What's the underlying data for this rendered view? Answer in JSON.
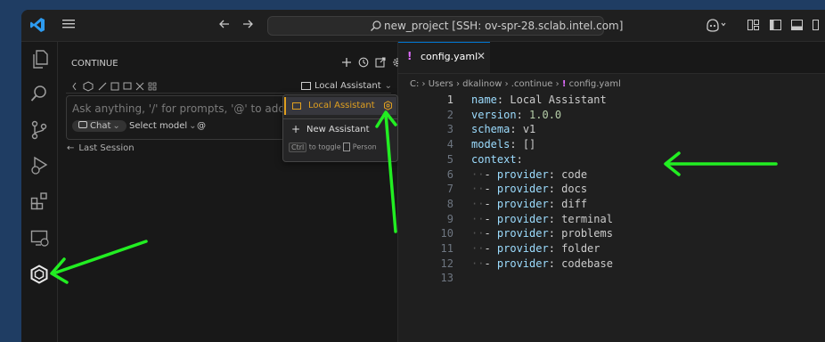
{
  "titlebar": {
    "search_text": "new_project [SSH: ov-spr-28.sclab.intel.com]"
  },
  "sidebar": {
    "title": "CONTINUE",
    "assistant_select": "Local Assistant",
    "input_placeholder": "Ask anything, '/' for prompts, '@' to add conte",
    "chat_label": "Chat",
    "select_model_label": "Select model",
    "at_label": "@",
    "last_session_label": "Last Session"
  },
  "dropdown": {
    "item_local": "Local Assistant",
    "item_new": "New Assistant",
    "hint_key": "Ctrl",
    "hint_text": "to toggle",
    "hint_extra": "Person"
  },
  "editor": {
    "tab_label": "config.yaml",
    "tab_icon": "!",
    "breadcrumb": [
      "C:",
      "Users",
      "dkalinow",
      ".continue",
      "config.yaml"
    ],
    "lines": [
      {
        "n": "1",
        "indent": "",
        "key": "name",
        "val": "Local Assistant",
        "vtype": "str"
      },
      {
        "n": "2",
        "indent": "",
        "key": "version",
        "val": "1.0.0",
        "vtype": "num"
      },
      {
        "n": "3",
        "indent": "",
        "key": "schema",
        "val": "v1",
        "vtype": "str"
      },
      {
        "n": "4",
        "indent": "",
        "key": "models",
        "val": "[]",
        "vtype": "str"
      },
      {
        "n": "5",
        "indent": "",
        "key": "context",
        "val": "",
        "vtype": "str"
      },
      {
        "n": "6",
        "indent": "- ",
        "key": "provider",
        "val": "code",
        "vtype": "str"
      },
      {
        "n": "7",
        "indent": "- ",
        "key": "provider",
        "val": "docs",
        "vtype": "str"
      },
      {
        "n": "8",
        "indent": "- ",
        "key": "provider",
        "val": "diff",
        "vtype": "str"
      },
      {
        "n": "9",
        "indent": "- ",
        "key": "provider",
        "val": "terminal",
        "vtype": "str"
      },
      {
        "n": "10",
        "indent": "- ",
        "key": "provider",
        "val": "problems",
        "vtype": "str"
      },
      {
        "n": "11",
        "indent": "- ",
        "key": "provider",
        "val": "folder",
        "vtype": "str"
      },
      {
        "n": "12",
        "indent": "- ",
        "key": "provider",
        "val": "codebase",
        "vtype": "str"
      },
      {
        "n": "13",
        "indent": "",
        "key": "",
        "val": "",
        "vtype": "str"
      }
    ]
  },
  "colors": {
    "accent_blue": "#0078d4",
    "annotation_green": "#22ee22",
    "yaml_key": "#9cdcfe",
    "yaml_number": "#b5cea8",
    "yaml_tab_icon": "#e06cff"
  },
  "icons": [
    "vscode-logo-icon",
    "menu-icon",
    "back-arrow-icon",
    "forward-arrow-icon",
    "search-icon",
    "copilot-icon",
    "layout-icon",
    "explorer-icon",
    "search-activity-icon",
    "source-control-icon",
    "run-debug-icon",
    "extensions-icon",
    "remote-explorer-icon",
    "continue-icon",
    "add-icon",
    "history-icon",
    "open-external-icon",
    "gear-icon",
    "close-icon"
  ]
}
